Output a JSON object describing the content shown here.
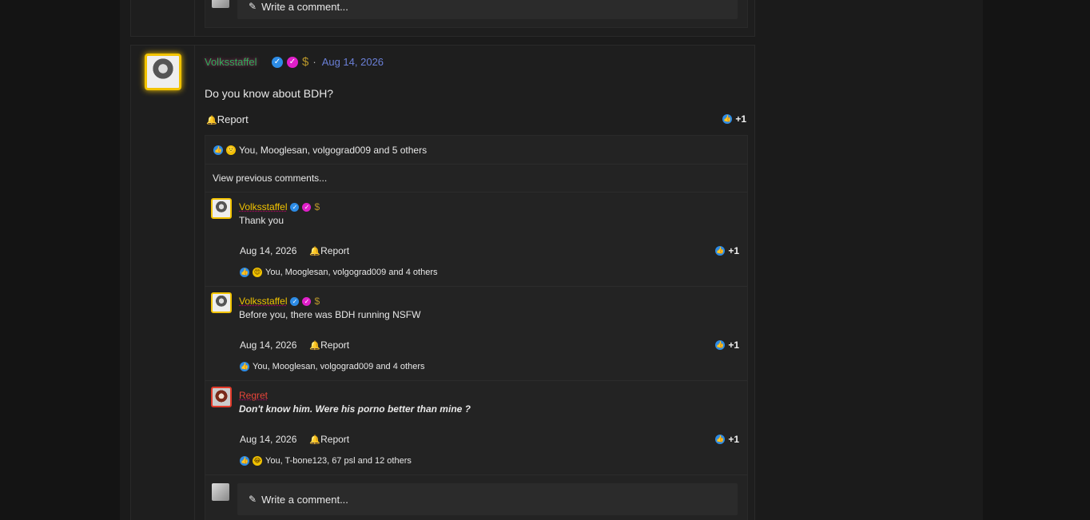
{
  "top_write": {
    "label": "Write a comment..."
  },
  "post": {
    "username": "Volksstaffel",
    "date": "Aug 14, 2026",
    "text": "Do you know about BDH?",
    "report": "Report",
    "likes": "+1",
    "reactions_text": "You, Mooglesan, volgograd009 and 5 others",
    "view_previous": "View previous comments..."
  },
  "comments": [
    {
      "username": "Volksstaffel",
      "text": "Thank you",
      "date": "Aug 14, 2026",
      "report": "Report",
      "likes": "+1",
      "reactions_text": "You, Mooglesan, volgograd009 and 4 others"
    },
    {
      "username": "Volksstaffel",
      "text": "Before you, there was BDH running NSFW",
      "date": "Aug 14, 2026",
      "report": "Report",
      "likes": "+1",
      "reactions_text": "You, Mooglesan, volgograd009 and 4 others"
    },
    {
      "username": "Regret",
      "text": "Don't know him. Were his porno better than mine ?",
      "date": "Aug 14, 2026",
      "report": "Report",
      "likes": "+1",
      "reactions_text": "You, T-bone123, 67 psl and 12 others"
    }
  ],
  "bottom_write": {
    "label": "Write a comment..."
  },
  "colors": {
    "accent_gold": "#f2c300",
    "verified_blue": "#2d8ce6",
    "pink_badge": "#e01fc9",
    "date_link": "#6a7fd6",
    "regret_red": "#e8453a"
  }
}
